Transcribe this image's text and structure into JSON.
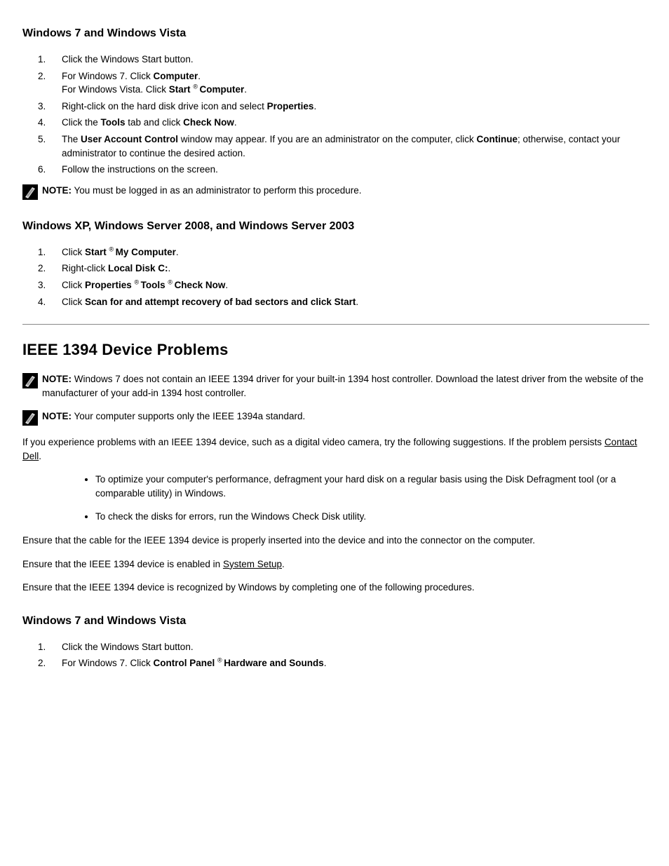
{
  "headings": {
    "win7vista": "Windows 7 and Windows Vista",
    "winxp_server": "Windows XP, Windows Server 2008, and Windows Server 2003"
  },
  "steps_a": [
    {
      "num": "1.",
      "text": "Click the Windows Start button."
    },
    {
      "num": "2.",
      "text_seg1": "For Windows 7. Click ",
      "bold1": "Computer",
      "text_seg2": ".",
      "line2_seg1": "For Windows Vista. Click ",
      "line2_bold": "Start ",
      "line2_seg2": "® ",
      "line2_bold2": "Computer",
      "line2_seg3": "."
    },
    {
      "num": "3.",
      "text_seg1": "Right-click on the hard disk drive icon and select ",
      "bold1": "Properties",
      "text_seg2": "."
    },
    {
      "num": "4.",
      "text_seg1": "Click the ",
      "bold1": "Tools",
      "text_seg2": " tab and click ",
      "bold2": "Check Now",
      "text_seg3": "."
    },
    {
      "num": "5.",
      "text_seg1": "The ",
      "bold1": "User Account Control",
      "text_seg2": " window may appear. If you are an administrator on the computer, click ",
      "bold2": "Continue",
      "text_seg3": "; otherwise, contact your administrator to continue the desired action."
    },
    {
      "num": "6.",
      "text": "Follow the instructions on the screen."
    }
  ],
  "note1": {
    "label": "NOTE:",
    "text": " You must be logged in as an administrator to perform this procedure."
  },
  "steps_b": [
    {
      "num": "1.",
      "text_seg1": "Click ",
      "bold1": "Start ",
      "text_seg2": "® ",
      "bold2": "My Computer",
      "text_seg3": "."
    },
    {
      "num": "2.",
      "text_seg1": "Right-click ",
      "bold1": "Local Disk C:",
      "text_seg2": "."
    },
    {
      "num": "3.",
      "text_seg1": "Click ",
      "bold1": "Properties ",
      "text_seg2": "® ",
      "bold2": "Tools ",
      "text_seg3": "® ",
      "bold3": "Check Now",
      "text_seg4": "."
    },
    {
      "num": "4.",
      "text_seg1": "Click ",
      "bold1": "Scan for and attempt recovery of bad sectors and click Start",
      "text_seg2": "."
    }
  ],
  "section_title": "IEEE 1394 Device Problems",
  "para1": {
    "seg1": "If you experience problems with an IEEE 1394 device, such as a digital video camera, try the following suggestions. If the problem persists ",
    "link": "Contact Dell",
    "seg2": "."
  },
  "note2_a": {
    "label": "NOTE:",
    "text": " Windows 7 does not contain an IEEE 1394 driver for your built-in 1394 host controller. Download the latest driver from the website of the manufacturer of your add-in 1394 host controller."
  },
  "note2_b": {
    "label": "NOTE:",
    "text": " Your computer supports only the IEEE 1394a standard."
  },
  "para2": {
    "seg1": "Ensure that the cable for the IEEE 1394 device is properly inserted into the device and into the connector on the computer."
  },
  "para3": {
    "seg1": "Ensure that the IEEE 1394 device is enabled in ",
    "link": "System Setup",
    "seg2": "."
  },
  "para4": {
    "seg1": "Ensure that the IEEE 1394 device is recognized by Windows by completing one of the following procedures."
  },
  "heading_bottom": "Windows 7 and Windows Vista",
  "steps_c": [
    {
      "num": "1.",
      "text": "Click the Windows Start button."
    },
    {
      "num": "2.",
      "text_seg1": "For Windows 7. Click ",
      "bold1": "Control Panel ",
      "text_seg2": "® ",
      "bold2": "Hardware and Sounds",
      "text_seg3": "."
    }
  ],
  "bullets": [
    "To optimize your computer's performance, defragment your hard disk on a regular basis using the Disk Defragment tool (or a comparable utility) in Windows.",
    "To check the disks for errors, run the Windows Check Disk utility."
  ]
}
